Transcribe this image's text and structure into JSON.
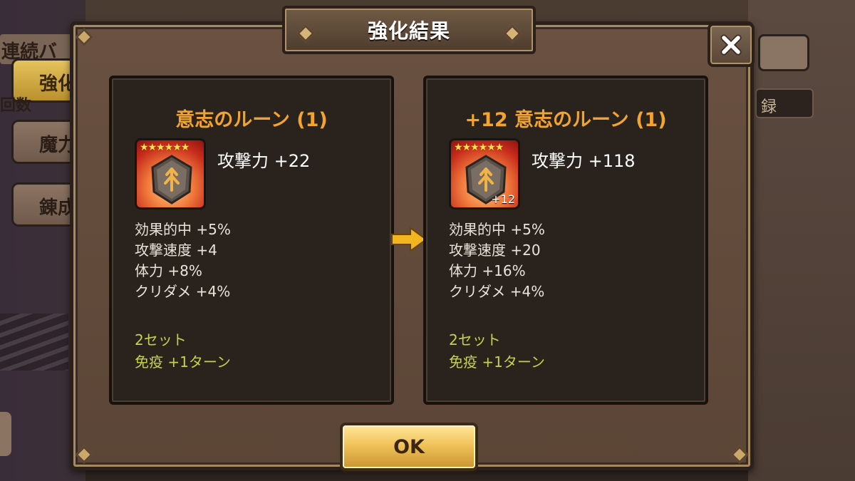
{
  "background": {
    "header_text": "連続バ",
    "tabs": [
      {
        "label": "強化"
      },
      {
        "label": "魔力発"
      },
      {
        "label": "錬成"
      }
    ],
    "side_text": "回数",
    "right_box_text": "録"
  },
  "dialog": {
    "title": "強化結果",
    "close_icon": "close-icon",
    "ok_label": "OK"
  },
  "before": {
    "name": "意志のルーン (1)",
    "stars": "★★★★★★",
    "level_badge": "",
    "main_stat": "攻撃力 +22",
    "sub_stats": [
      "効果的中 +5%",
      "攻撃速度 +4",
      "体力 +8%",
      "クリダメ +4%"
    ],
    "set_label": "2セット",
    "set_effect": "免疫 +1ターン"
  },
  "after": {
    "name": "+12 意志のルーン (1)",
    "stars": "★★★★★★",
    "level_badge": "+12",
    "main_stat": "攻撃力 +118",
    "sub_stats": [
      "効果的中 +5%",
      "攻撃速度 +20",
      "体力 +16%",
      "クリダメ +4%"
    ],
    "set_label": "2セット",
    "set_effect": "免疫 +1ターン"
  },
  "colors": {
    "rune_name": "#f3a42f",
    "set_text": "#c6d24a",
    "ok_button": "#f1c35a"
  }
}
